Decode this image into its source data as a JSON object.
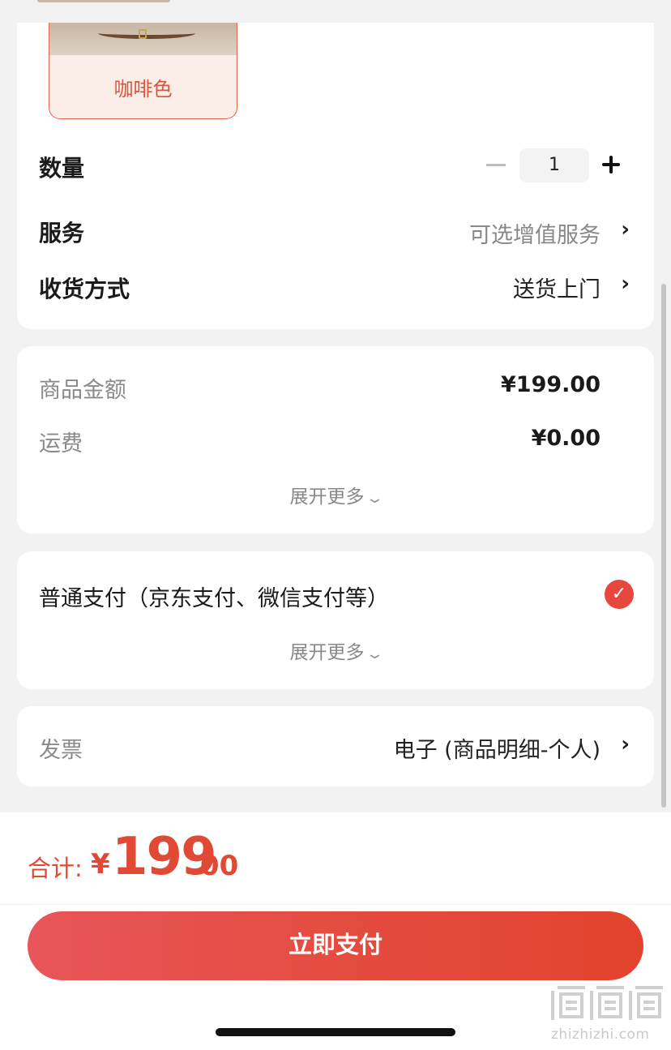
{
  "product": {
    "variant_label": "咖啡色"
  },
  "quantity": {
    "label": "数量",
    "value": "1"
  },
  "service": {
    "label": "服务",
    "value": "可选增值服务"
  },
  "delivery": {
    "label": "收货方式",
    "value": "送货上门"
  },
  "amounts": {
    "goods_label": "商品金额",
    "goods_value": "¥199.00",
    "shipping_label": "运费",
    "shipping_value": "¥0.00",
    "expand_label": "展开更多"
  },
  "payment": {
    "method_label": "普通支付（京东支付、微信支付等）",
    "expand_label": "展开更多"
  },
  "invoice": {
    "label": "发票",
    "value": "电子 (商品明细-个人)"
  },
  "total": {
    "label": "合计:",
    "currency": "¥",
    "integer": "199",
    "decimal": ".00"
  },
  "pay_button": {
    "label": "立即支付"
  },
  "watermark": {
    "site": "zhizhizhi.com"
  },
  "colors": {
    "accent": "#e04a35",
    "check": "#e8473e",
    "background": "#f2f2f2"
  },
  "icons": {
    "chevron_right": "›",
    "chevron_down": "⌄",
    "check": "✓"
  }
}
